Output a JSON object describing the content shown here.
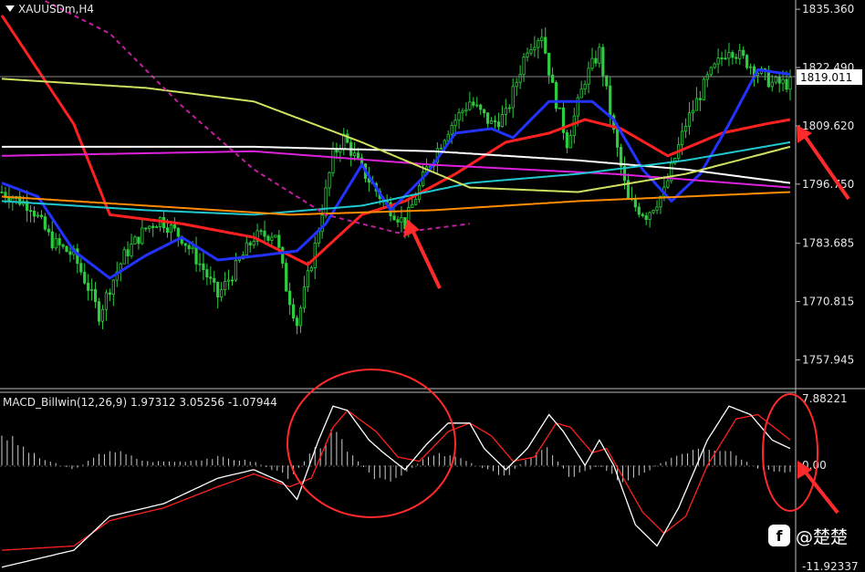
{
  "chart_data": [
    {
      "type": "candlestick",
      "symbol_label": "XAUUSDm,H4",
      "y_ticks": [
        "1835.360",
        "1822.490",
        "1809.620",
        "1796.750",
        "1783.685",
        "1770.815",
        "1757.945"
      ],
      "current_price": "1819.011",
      "ylim": [
        1752,
        1837
      ],
      "n_bars": 220,
      "price_path": [
        [
          0,
          1795
        ],
        [
          8,
          1792
        ],
        [
          14,
          1784
        ],
        [
          20,
          1781
        ],
        [
          24,
          1774
        ],
        [
          27,
          1768
        ],
        [
          30,
          1774
        ],
        [
          34,
          1781
        ],
        [
          40,
          1787
        ],
        [
          44,
          1789
        ],
        [
          50,
          1785
        ],
        [
          56,
          1778
        ],
        [
          60,
          1772
        ],
        [
          64,
          1777
        ],
        [
          70,
          1785
        ],
        [
          76,
          1786
        ],
        [
          79,
          1774
        ],
        [
          82,
          1766
        ],
        [
          87,
          1783
        ],
        [
          92,
          1803
        ],
        [
          95,
          1807
        ],
        [
          100,
          1800
        ],
        [
          106,
          1793
        ],
        [
          112,
          1788
        ],
        [
          118,
          1800
        ],
        [
          124,
          1809
        ],
        [
          130,
          1815
        ],
        [
          136,
          1810
        ],
        [
          140,
          1812
        ],
        [
          146,
          1827
        ],
        [
          150,
          1830
        ],
        [
          153,
          1818
        ],
        [
          157,
          1806
        ],
        [
          162,
          1820
        ],
        [
          166,
          1826
        ],
        [
          170,
          1808
        ],
        [
          174,
          1793
        ],
        [
          179,
          1790
        ],
        [
          184,
          1795
        ],
        [
          190,
          1810
        ],
        [
          196,
          1820
        ],
        [
          202,
          1827
        ],
        [
          208,
          1823
        ],
        [
          214,
          1819
        ],
        [
          219,
          1819
        ]
      ],
      "moving_averages": [
        {
          "color": "#ff2020",
          "points": [
            [
              0,
              1834
            ],
            [
              20,
              1810
            ],
            [
              30,
              1790
            ],
            [
              50,
              1788
            ],
            [
              70,
              1785
            ],
            [
              85,
              1779
            ],
            [
              100,
              1790
            ],
            [
              112,
              1793
            ],
            [
              126,
              1799
            ],
            [
              140,
              1806
            ],
            [
              152,
              1808
            ],
            [
              162,
              1811
            ],
            [
              172,
              1809
            ],
            [
              185,
              1803
            ],
            [
              200,
              1808
            ],
            [
              212,
              1810
            ],
            [
              219,
              1811
            ]
          ]
        },
        {
          "color": "#2233ff",
          "points": [
            [
              0,
              1797
            ],
            [
              10,
              1794
            ],
            [
              20,
              1782
            ],
            [
              30,
              1776
            ],
            [
              40,
              1781
            ],
            [
              50,
              1785
            ],
            [
              60,
              1780
            ],
            [
              72,
              1781
            ],
            [
              82,
              1782
            ],
            [
              90,
              1788
            ],
            [
              100,
              1801
            ],
            [
              108,
              1791
            ],
            [
              118,
              1799
            ],
            [
              126,
              1808
            ],
            [
              136,
              1809
            ],
            [
              142,
              1807
            ],
            [
              152,
              1815
            ],
            [
              164,
              1815
            ],
            [
              170,
              1811
            ],
            [
              178,
              1800
            ],
            [
              186,
              1793
            ],
            [
              194,
              1799
            ],
            [
              202,
              1810
            ],
            [
              210,
              1822
            ],
            [
              219,
              1821
            ]
          ]
        },
        {
          "color": "#ffffff",
          "points": [
            [
              0,
              1805
            ],
            [
              70,
              1805
            ],
            [
              120,
              1804
            ],
            [
              160,
              1802
            ],
            [
              190,
              1800
            ],
            [
              219,
              1797
            ]
          ]
        },
        {
          "color": "#dd22dd",
          "points": [
            [
              0,
              1803
            ],
            [
              70,
              1804
            ],
            [
              120,
              1801
            ],
            [
              170,
              1799
            ],
            [
              219,
              1796
            ]
          ]
        },
        {
          "color": "#20c8d0",
          "points": [
            [
              0,
              1793
            ],
            [
              40,
              1791
            ],
            [
              70,
              1790
            ],
            [
              100,
              1792
            ],
            [
              130,
              1797
            ],
            [
              160,
              1799
            ],
            [
              190,
              1802
            ],
            [
              219,
              1806
            ]
          ]
        },
        {
          "color": "#ff8c00",
          "points": [
            [
              0,
              1794
            ],
            [
              40,
              1792
            ],
            [
              80,
              1790
            ],
            [
              120,
              1791
            ],
            [
              160,
              1793
            ],
            [
              190,
              1794
            ],
            [
              219,
              1795
            ]
          ]
        },
        {
          "color": "#d0e060",
          "points": [
            [
              0,
              1820
            ],
            [
              40,
              1818
            ],
            [
              70,
              1815
            ],
            [
              100,
              1806
            ],
            [
              130,
              1796
            ],
            [
              160,
              1795
            ],
            [
              190,
              1799
            ],
            [
              219,
              1805
            ]
          ]
        },
        {
          "color": "#c020a0",
          "points": [
            [
              10,
              1838
            ],
            [
              30,
              1830
            ],
            [
              50,
              1814
            ],
            [
              70,
              1800
            ],
            [
              90,
              1790
            ],
            [
              110,
              1786
            ],
            [
              130,
              1788
            ]
          ]
        }
      ]
    },
    {
      "type": "macd",
      "label": "MACD_Billwin(12,26,9) 1.97312 3.05256 -1.07944",
      "y_ticks": [
        "7.88221",
        "0.00",
        "-11.92337"
      ],
      "ylim": [
        -11.92337,
        7.88221
      ],
      "n_bars": 220,
      "macd_line": [
        [
          0,
          -12
        ],
        [
          20,
          -10
        ],
        [
          30,
          -6
        ],
        [
          45,
          -4.5
        ],
        [
          60,
          -1.5
        ],
        [
          70,
          -0.5
        ],
        [
          78,
          -2
        ],
        [
          82,
          -4
        ],
        [
          88,
          3
        ],
        [
          92,
          7
        ],
        [
          96,
          6.5
        ],
        [
          102,
          3
        ],
        [
          106,
          1.5
        ],
        [
          112,
          -0.5
        ],
        [
          118,
          2.5
        ],
        [
          124,
          5
        ],
        [
          130,
          5
        ],
        [
          134,
          2
        ],
        [
          140,
          -0.5
        ],
        [
          146,
          2
        ],
        [
          152,
          6
        ],
        [
          156,
          4
        ],
        [
          162,
          0
        ],
        [
          166,
          3
        ],
        [
          170,
          0
        ],
        [
          176,
          -7
        ],
        [
          182,
          -9.5
        ],
        [
          188,
          -5
        ],
        [
          196,
          3
        ],
        [
          202,
          7
        ],
        [
          208,
          6
        ],
        [
          214,
          3
        ],
        [
          219,
          2
        ]
      ],
      "signal_line": [
        [
          0,
          -10
        ],
        [
          20,
          -9.5
        ],
        [
          30,
          -6.5
        ],
        [
          45,
          -5
        ],
        [
          60,
          -2.5
        ],
        [
          70,
          -1
        ],
        [
          80,
          -2.5
        ],
        [
          86,
          -1.5
        ],
        [
          92,
          4.5
        ],
        [
          96,
          6.5
        ],
        [
          104,
          4
        ],
        [
          110,
          1
        ],
        [
          116,
          0.5
        ],
        [
          124,
          4
        ],
        [
          130,
          5
        ],
        [
          136,
          3.5
        ],
        [
          142,
          0.5
        ],
        [
          148,
          1
        ],
        [
          154,
          5
        ],
        [
          158,
          4.5
        ],
        [
          164,
          1.5
        ],
        [
          168,
          2
        ],
        [
          172,
          -1
        ],
        [
          178,
          -5.5
        ],
        [
          184,
          -8
        ],
        [
          190,
          -6
        ],
        [
          196,
          0
        ],
        [
          204,
          5.5
        ],
        [
          210,
          6
        ],
        [
          216,
          4
        ],
        [
          219,
          3
        ]
      ],
      "histogram_envelope": [
        [
          0,
          4
        ],
        [
          10,
          1
        ],
        [
          20,
          -0.5
        ],
        [
          30,
          2
        ],
        [
          40,
          0.5
        ],
        [
          50,
          0.5
        ],
        [
          60,
          1
        ],
        [
          70,
          0.5
        ],
        [
          80,
          -1.5
        ],
        [
          86,
          1.5
        ],
        [
          92,
          4
        ],
        [
          98,
          1
        ],
        [
          104,
          -2
        ],
        [
          110,
          -1.5
        ],
        [
          118,
          1
        ],
        [
          124,
          1.5
        ],
        [
          132,
          0
        ],
        [
          140,
          -1.5
        ],
        [
          146,
          1
        ],
        [
          152,
          2
        ],
        [
          158,
          -1.5
        ],
        [
          166,
          0
        ],
        [
          172,
          -2
        ],
        [
          178,
          -1
        ],
        [
          186,
          1
        ],
        [
          194,
          2.5
        ],
        [
          202,
          2
        ],
        [
          210,
          -0.5
        ],
        [
          219,
          -1
        ]
      ]
    }
  ]
}
